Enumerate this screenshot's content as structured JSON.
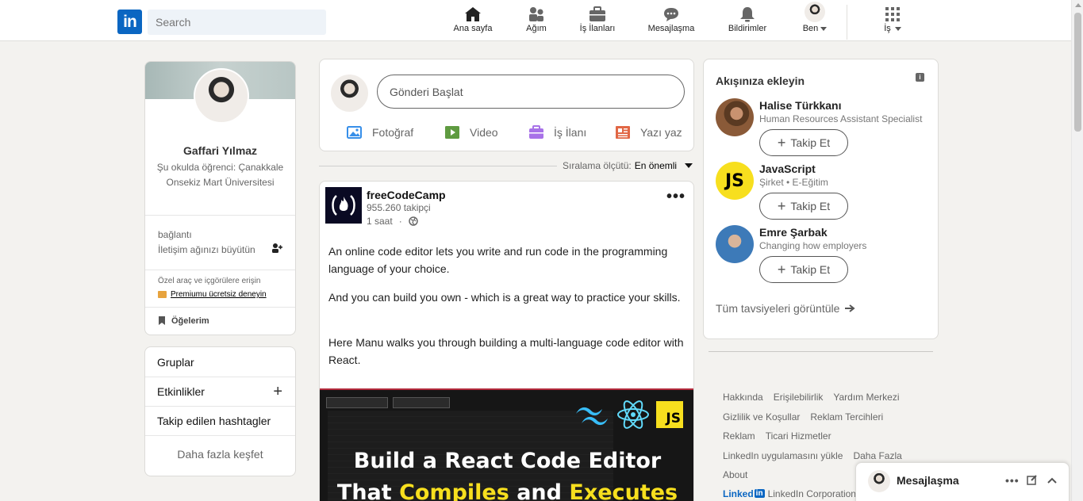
{
  "nav": {
    "search_placeholder": "Search",
    "items": [
      {
        "label": "Ana sayfa",
        "icon": "home-icon"
      },
      {
        "label": "Ağım",
        "icon": "network-icon"
      },
      {
        "label": "İş İlanları",
        "icon": "briefcase-icon"
      },
      {
        "label": "Mesajlaşma",
        "icon": "messaging-icon"
      },
      {
        "label": "Bildirimler",
        "icon": "bell-icon"
      },
      {
        "label": "Ben",
        "icon": "avatar"
      },
      {
        "label": "İş",
        "icon": "grid-icon"
      }
    ]
  },
  "profile": {
    "name": "Gaffari Yılmaz",
    "subtitle": "Şu okulda öğrenci: Çanakkale Onsekiz Mart Üniversitesi",
    "connections_label": "bağlantı",
    "grow_network": "İletişim ağınızı büyütün",
    "premium_hint": "Özel araç ve içgörülere erişin",
    "premium_link": "Premiumu ücretsiz deneyin",
    "my_items": "Öğelerim"
  },
  "groups": {
    "items": [
      "Gruplar",
      "Etkinlikler",
      "Takip edilen hashtagler"
    ],
    "more": "Daha fazla keşfet"
  },
  "share": {
    "start_post": "Gönderi Başlat",
    "actions": [
      {
        "label": "Fotoğraf",
        "icon": "photo-icon",
        "color": "#378fe9"
      },
      {
        "label": "Video",
        "icon": "video-icon",
        "color": "#5f9b41"
      },
      {
        "label": "İş İlanı",
        "icon": "job-icon",
        "color": "#a872e8"
      },
      {
        "label": "Yazı yaz",
        "icon": "article-icon",
        "color": "#e16745"
      }
    ]
  },
  "sort": {
    "label": "Sıralama ölçütü:",
    "value": "En önemli"
  },
  "post": {
    "author": "freeCodeCamp",
    "followers": "955.260 takipçi",
    "time": "1 saat",
    "paragraphs": [
      "An online code editor lets you write and run code in the programming language of your choice.",
      "And you can build you own - which is a great way to practice your skills.",
      "Here Manu walks you through building a multi-language code editor with React."
    ],
    "image_headline_1": "Build a React Code Editor",
    "image_headline_2_a": "That ",
    "image_headline_2_b": "Compiles",
    "image_headline_2_c": " and ",
    "image_headline_2_d": "Executes",
    "image_badge": "JS"
  },
  "reco": {
    "title": "Akışınıza ekleyin",
    "people": [
      {
        "name": "Halise Türkkanı",
        "desc": "Human Resources Assistant Specialist",
        "button": "Takip Et"
      },
      {
        "name": "JavaScript",
        "desc": "Şirket • E-Eğitim",
        "button": "Takip Et",
        "badge": "JS"
      },
      {
        "name": "Emre Şarbak",
        "desc": "Changing how employers",
        "button": "Takip Et"
      }
    ],
    "all_link": "Tüm tavsiyeleri görüntüle"
  },
  "footer": {
    "rows": [
      [
        "Hakkında",
        "Erişilebilirlik",
        "Yardım Merkezi"
      ],
      [
        "Gizlilik ve Koşullar",
        "Reklam Tercihleri"
      ],
      [
        "Reklam",
        "Ticari Hizmetler"
      ],
      [
        "LinkedIn uygulamasını yükle",
        "Daha Fazla"
      ],
      [
        "About"
      ]
    ],
    "brand_word": "Linked",
    "brand_box": "in",
    "corp": "LinkedIn Corporation"
  },
  "messaging": {
    "title": "Mesajlaşma"
  },
  "colors": {
    "brand": "#0a66c2",
    "bg": "#f3f2ef",
    "js_yellow": "#f7df1e"
  }
}
